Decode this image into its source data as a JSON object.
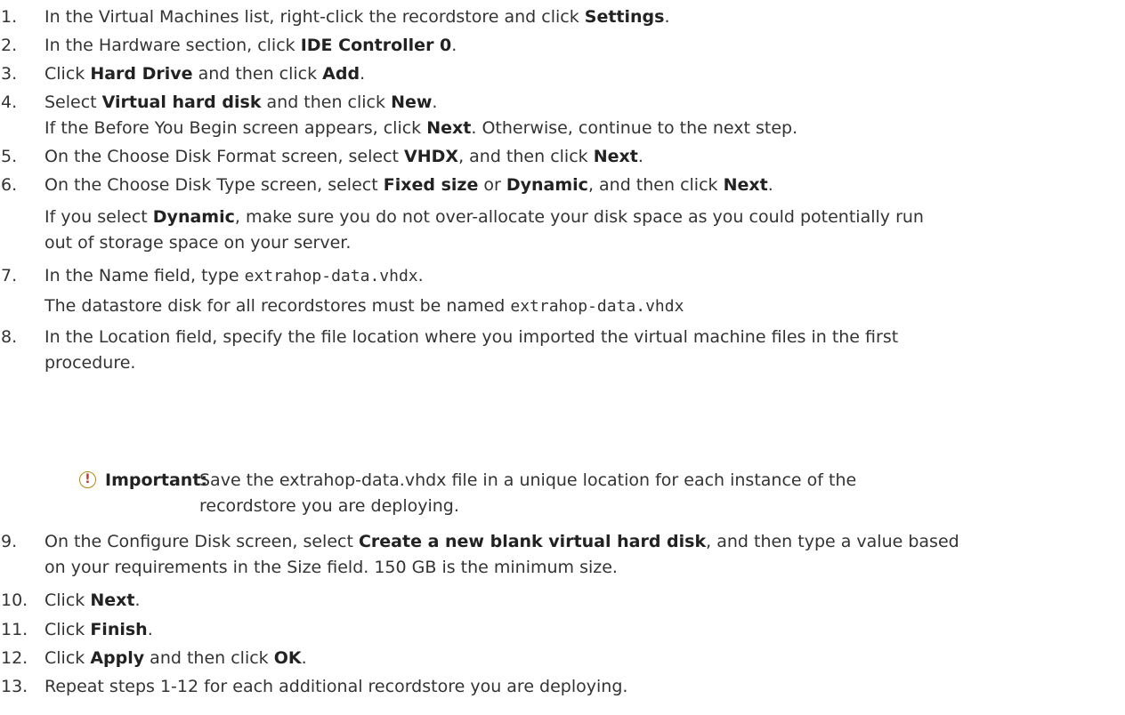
{
  "steps": [
    {
      "number": "1.",
      "pre": "In the Virtual Machines list, right-click the recordstore and click ",
      "b1": "Settings",
      "post": "."
    },
    {
      "number": "2.",
      "pre": "In the Hardware section, click ",
      "b1": "IDE Controller 0",
      "post": "."
    },
    {
      "number": "3.",
      "pre": "Click ",
      "b1": "Hard Drive",
      "mid": " and then click ",
      "b2": "Add",
      "post": "."
    },
    {
      "number": "4.",
      "pre": "Select ",
      "b1": "Virtual hard disk",
      "mid": " and then click ",
      "b2": "New",
      "post": ".",
      "note_pre": "If the Before You Begin screen appears, click ",
      "note_b": "Next",
      "note_post": ". Otherwise, continue to the next step."
    },
    {
      "number": "5.",
      "pre": "On the Choose Disk Format screen, select ",
      "b1": "VHDX",
      "mid": ", and then click ",
      "b2": "Next",
      "post": "."
    },
    {
      "number": "6.",
      "pre": "On the Choose Disk Type screen, select ",
      "b1": "Fixed size",
      "mid": " or ",
      "b2": "Dynamic",
      "mid2": ", and then click ",
      "b3": "Next",
      "post": ".",
      "note_pre": "If you select ",
      "note_b": "Dynamic",
      "note_post": ", make sure you do not over-allocate your disk space as you could potentially run",
      "note_line2": "out of storage space on your server."
    },
    {
      "number": "7.",
      "pre": "In the Name field, type ",
      "code": "extrahop-data.vhdx",
      "post": ".",
      "note_pre": "The datastore disk for all recordstores must be named ",
      "note_code": "extrahop-data.vhdx"
    },
    {
      "number": "8.",
      "line1": "In the Location field, specify the file location where you imported the virtual machine files in the first",
      "line2": "procedure.",
      "important_label": "Important:",
      "important_line1": "Save the extrahop-data.vhdx file in a unique location for each instance of the",
      "important_line2": "recordstore you are deploying."
    },
    {
      "number": "9.",
      "pre": "On the Configure Disk screen, select ",
      "b1": "Create a new blank virtual hard disk",
      "post": ", and then type a value based",
      "line2": "on your requirements in the Size field. 150 GB is the minimum size."
    },
    {
      "number": "10.",
      "pre": "Click ",
      "b1": "Next",
      "post": "."
    },
    {
      "number": "11.",
      "pre": "Click ",
      "b1": "Finish",
      "post": "."
    },
    {
      "number": "12.",
      "pre": "Click ",
      "b1": "Apply",
      "mid": " and then click ",
      "b2": "OK",
      "post": "."
    },
    {
      "number": "13.",
      "pre": "Repeat steps 1-12 for each additional recordstore you are deploying."
    }
  ],
  "important_icon": "exclamation-circle-icon"
}
